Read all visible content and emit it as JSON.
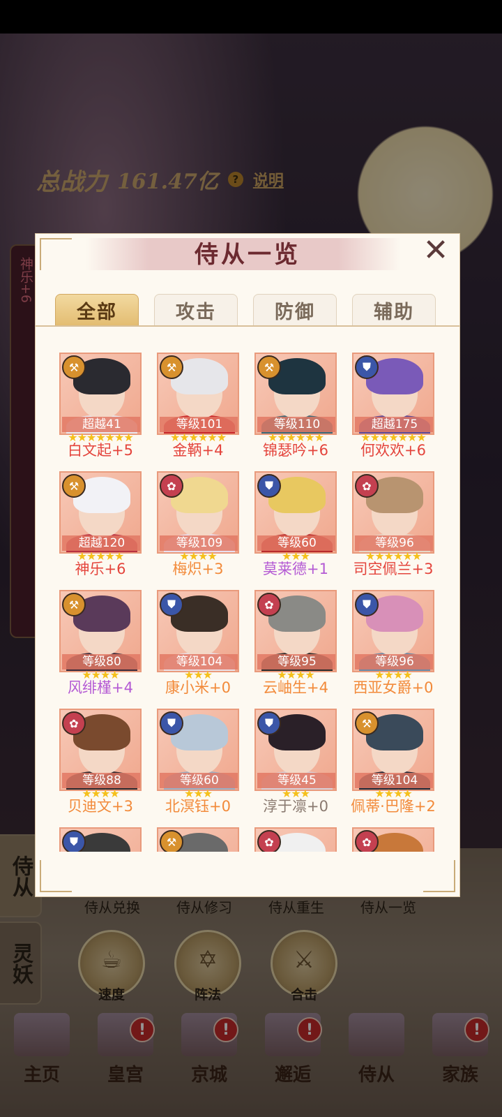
{
  "power": {
    "label": "总战力",
    "value": "161.47亿",
    "help_icon": "?",
    "help_label": "说明"
  },
  "side_card": {
    "text": "神乐+6"
  },
  "modal": {
    "title": "侍从一览",
    "close_icon": "close-x",
    "tabs": [
      {
        "label": "全部",
        "active": true
      },
      {
        "label": "攻击",
        "active": false
      },
      {
        "label": "防御",
        "active": false
      },
      {
        "label": "辅助",
        "active": false
      }
    ]
  },
  "cards": [
    {
      "level": "超越41",
      "name": "白文起+5",
      "role": "atk",
      "stars": 7,
      "name_color": "#e4443c",
      "hair": "#2a2a30",
      "outfit": "#e8eaf2"
    },
    {
      "level": "等级101",
      "name": "金鞆+4",
      "role": "atk",
      "stars": 6,
      "name_color": "#e4443c",
      "hair": "#e6e6ea",
      "outfit": "#c8262a"
    },
    {
      "level": "等级110",
      "name": "锦瑟吟+6",
      "role": "atk",
      "stars": 6,
      "name_color": "#e4443c",
      "hair": "#1e3440",
      "outfit": "#3a6a7a"
    },
    {
      "level": "超越175",
      "name": "何欢欢+6",
      "role": "def",
      "stars": 7,
      "name_color": "#e4443c",
      "hair": "#7a5ab8",
      "outfit": "#5a4a9a"
    },
    {
      "level": "超越120",
      "name": "神乐+6",
      "role": "atk",
      "stars": 5,
      "name_color": "#e4443c",
      "hair": "#f2f2f6",
      "outfit": "#b83040"
    },
    {
      "level": "等级109",
      "name": "梅炽+3",
      "role": "sup",
      "stars": 4,
      "name_color": "#f28a3a",
      "hair": "#f0d890",
      "outfit": "#e8e0f0"
    },
    {
      "level": "等级60",
      "name": "莫莱德+1",
      "role": "def",
      "stars": 3,
      "name_color": "#b45ad4",
      "hair": "#e8c860",
      "outfit": "#b82a2a"
    },
    {
      "level": "等级96",
      "name": "司空佩兰+3",
      "role": "sup",
      "stars": 6,
      "name_color": "#e4443c",
      "hair": "#b89470",
      "outfit": "#e6d8c8"
    },
    {
      "level": "等级80",
      "name": "风绯槿+4",
      "role": "atk",
      "stars": 4,
      "name_color": "#b45ad4",
      "hair": "#5a3a5a",
      "outfit": "#3a2a3a"
    },
    {
      "level": "等级104",
      "name": "康小米+0",
      "role": "def",
      "stars": 3,
      "name_color": "#f28a3a",
      "hair": "#3a2e26",
      "outfit": "#eae0e6"
    },
    {
      "level": "等级95",
      "name": "云岫生+4",
      "role": "sup",
      "stars": 4,
      "name_color": "#f28a3a",
      "hair": "#8a8a86",
      "outfit": "#2a2a2a"
    },
    {
      "level": "等级96",
      "name": "西亚女爵+0",
      "role": "def",
      "stars": 4,
      "name_color": "#f28a3a",
      "hair": "#d890b8",
      "outfit": "#6a8aa8"
    },
    {
      "level": "等级88",
      "name": "贝迪文+3",
      "role": "sup",
      "stars": 4,
      "name_color": "#f28a3a",
      "hair": "#7a4a2e",
      "outfit": "#2a2a30"
    },
    {
      "level": "等级60",
      "name": "北溟钰+0",
      "role": "def",
      "stars": 3,
      "name_color": "#f28a3a",
      "hair": "#b8c8d8",
      "outfit": "#9ab0c6"
    },
    {
      "level": "等级45",
      "name": "淳于凛+0",
      "role": "def",
      "stars": 3,
      "name_color": "#8a7a70",
      "hair": "#2a2028",
      "outfit": "#d8d0d8"
    },
    {
      "level": "等级104",
      "name": "佩蒂·巴隆+2",
      "role": "atk",
      "stars": 4,
      "name_color": "#f28a3a",
      "hair": "#3a4a5a",
      "outfit": "#1e2a3a"
    },
    {
      "level": "",
      "name": "",
      "role": "def",
      "stars": 0,
      "name_color": "#f28a3a",
      "hair": "#3a3a3a",
      "outfit": "#5a5a5a"
    },
    {
      "level": "",
      "name": "",
      "role": "atk",
      "stars": 0,
      "name_color": "#f28a3a",
      "hair": "#6a6a6a",
      "outfit": "#4a4a4a"
    },
    {
      "level": "",
      "name": "",
      "role": "sup",
      "stars": 0,
      "name_color": "#f28a3a",
      "hair": "#f0f0f0",
      "outfit": "#e0e0e0"
    },
    {
      "level": "",
      "name": "",
      "role": "sup",
      "stars": 0,
      "name_color": "#f28a3a",
      "hair": "#c8783a",
      "outfit": "#e8a870"
    }
  ],
  "side_tabs": [
    {
      "label": "侍从",
      "active": true
    },
    {
      "label": "灵妖",
      "active": false
    }
  ],
  "functions": [
    "侍从兑换",
    "侍从修习",
    "侍从重生",
    "侍从一览"
  ],
  "circle_buttons": [
    {
      "label": "速度",
      "icon": "teacup-icon"
    },
    {
      "label": "阵法",
      "icon": "hexagram-icon"
    },
    {
      "label": "合击",
      "icon": "crossed-swords-icon"
    }
  ],
  "bottom_nav": [
    {
      "label": "主页",
      "badge": ""
    },
    {
      "label": "皇宫",
      "badge": "!"
    },
    {
      "label": "京城",
      "badge": "!"
    },
    {
      "label": "邂逅",
      "badge": "!"
    },
    {
      "label": "侍从",
      "badge": ""
    },
    {
      "label": "家族",
      "badge": "!"
    }
  ]
}
